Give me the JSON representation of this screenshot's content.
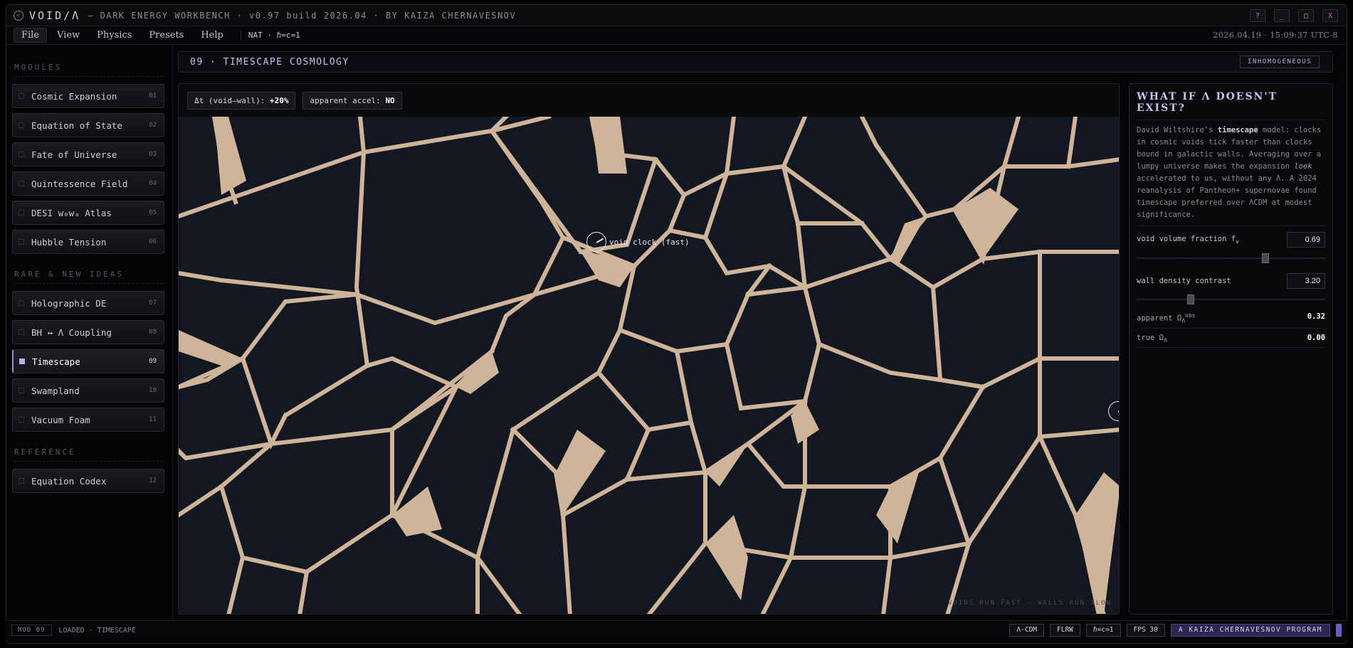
{
  "titlebar": {
    "app_name": "VOID/Λ",
    "title_rest": "– DARK ENERGY WORKBENCH · v0.97 build 2026.04 · BY KAIZA CHERNAVESNOV",
    "help_btn": "?",
    "min_btn": "_",
    "max_btn": "□",
    "close_btn": "X"
  },
  "menubar": {
    "items": [
      "File",
      "View",
      "Physics",
      "Presets",
      "Help"
    ],
    "units": "NAT · ℏ=c=1",
    "clock": "2026.04.19 · 15:09:37 UTC-8"
  },
  "sidebar": {
    "sections": [
      {
        "title": "MODULES",
        "items": [
          {
            "label": "Cosmic Expansion",
            "num": "01"
          },
          {
            "label": "Equation of State",
            "num": "02"
          },
          {
            "label": "Fate of Universe",
            "num": "03"
          },
          {
            "label": "Quintessence Field",
            "num": "04"
          },
          {
            "label": "DESI w₀wₐ Atlas",
            "num": "05"
          },
          {
            "label": "Hubble Tension",
            "num": "06"
          }
        ]
      },
      {
        "title": "RARE & NEW IDEAS",
        "items": [
          {
            "label": "Holographic DE",
            "num": "07"
          },
          {
            "label": "BH ↔ Λ Coupling",
            "num": "08"
          },
          {
            "label": "Timescape",
            "num": "09",
            "active": true
          },
          {
            "label": "Swampland",
            "num": "10"
          },
          {
            "label": "Vacuum Foam",
            "num": "11"
          }
        ]
      },
      {
        "title": "REFERENCE",
        "items": [
          {
            "label": "Equation Codex",
            "num": "12"
          }
        ]
      }
    ]
  },
  "module": {
    "title": "09 · TIMESCAPE COSMOLOGY",
    "badge": "INHOMOGENEOUS"
  },
  "sim": {
    "chip_dt_label": "Δt (void–wall): ",
    "chip_dt_value": "+20%",
    "chip_accel_label": "apparent accel: ",
    "chip_accel_value": "NO",
    "void_clock_label": "void clock (fast)",
    "footnote": "VOIDS RUN FAST · WALLS RUN SLOW",
    "colors": {
      "background": "#0d0f14",
      "wall": "#cfb49a"
    }
  },
  "info": {
    "title": "WHAT IF Λ DOESN'T EXIST?",
    "text_1": "David Wiltshire's ",
    "text_bold": "timescape",
    "text_2": " model: clocks in cosmic voids tick faster than clocks bound in galactic walls. Averaging over a lumpy universe makes the expansion ",
    "text_italic": "look",
    "text_3": " accelerated to us, without any Λ. A 2024 reanalysis of Pantheon+ supernovae found timescape preferred over ΛCDM at modest significance.",
    "param1_label": "void volume fraction f",
    "param1_sub": "v",
    "param1_value": "0.69",
    "param1_fraction": 0.69,
    "param2_label": "wall density contrast",
    "param2_value": "3.20",
    "param2_fraction": 0.28,
    "readout1_label": "apparent Ω",
    "readout1_sub": "Λ",
    "readout1_sup": "obs",
    "readout1_value": "0.32",
    "readout2_label": "true Ω",
    "readout2_sub": "Λ",
    "readout2_value": "0.00"
  },
  "status": {
    "mod": "MOD 09",
    "loaded": "LOADED · TIMESCAPE",
    "chips": [
      "Λ-CDM",
      "FLRW",
      "ℏ=c=1",
      "FPS 30"
    ],
    "brand": "A KAIZA CHERNAVESNOV PROGRAM"
  }
}
